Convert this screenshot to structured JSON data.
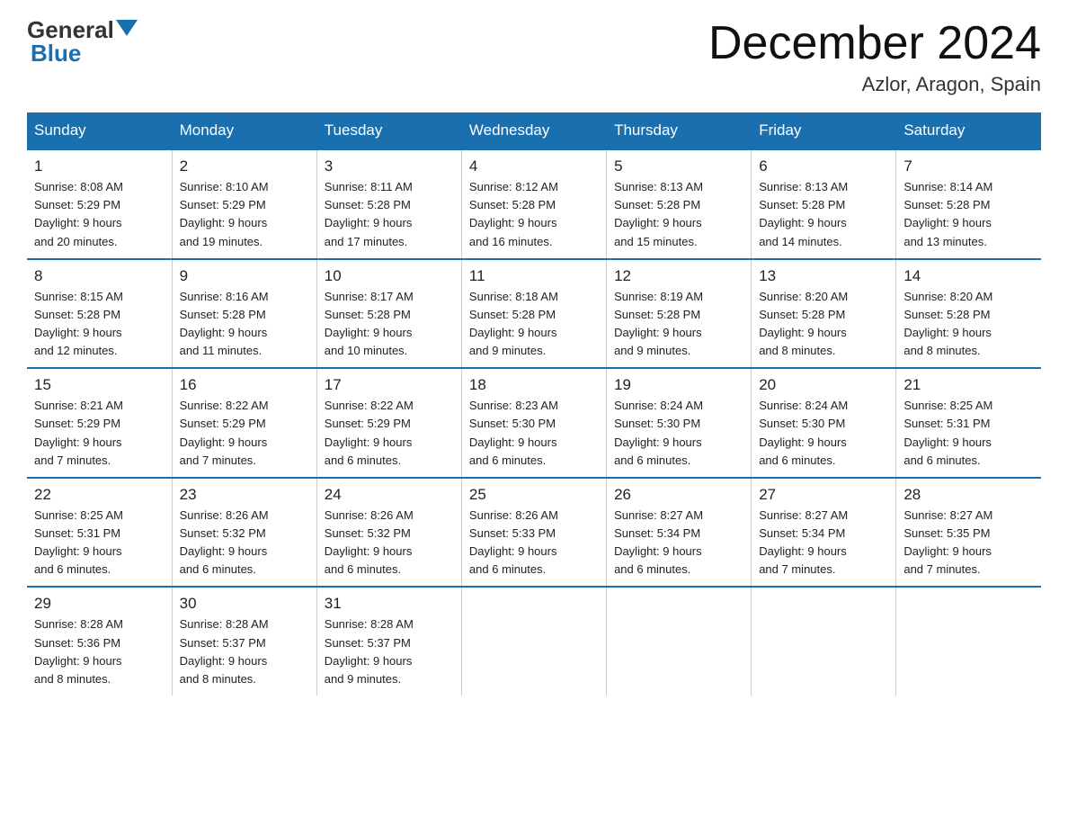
{
  "header": {
    "logo_general": "General",
    "logo_blue": "Blue",
    "month_title": "December 2024",
    "location": "Azlor, Aragon, Spain"
  },
  "weekdays": [
    "Sunday",
    "Monday",
    "Tuesday",
    "Wednesday",
    "Thursday",
    "Friday",
    "Saturday"
  ],
  "weeks": [
    [
      {
        "day": "1",
        "sunrise": "8:08 AM",
        "sunset": "5:29 PM",
        "daylight": "9 hours and 20 minutes."
      },
      {
        "day": "2",
        "sunrise": "8:10 AM",
        "sunset": "5:29 PM",
        "daylight": "9 hours and 19 minutes."
      },
      {
        "day": "3",
        "sunrise": "8:11 AM",
        "sunset": "5:28 PM",
        "daylight": "9 hours and 17 minutes."
      },
      {
        "day": "4",
        "sunrise": "8:12 AM",
        "sunset": "5:28 PM",
        "daylight": "9 hours and 16 minutes."
      },
      {
        "day": "5",
        "sunrise": "8:13 AM",
        "sunset": "5:28 PM",
        "daylight": "9 hours and 15 minutes."
      },
      {
        "day": "6",
        "sunrise": "8:13 AM",
        "sunset": "5:28 PM",
        "daylight": "9 hours and 14 minutes."
      },
      {
        "day": "7",
        "sunrise": "8:14 AM",
        "sunset": "5:28 PM",
        "daylight": "9 hours and 13 minutes."
      }
    ],
    [
      {
        "day": "8",
        "sunrise": "8:15 AM",
        "sunset": "5:28 PM",
        "daylight": "9 hours and 12 minutes."
      },
      {
        "day": "9",
        "sunrise": "8:16 AM",
        "sunset": "5:28 PM",
        "daylight": "9 hours and 11 minutes."
      },
      {
        "day": "10",
        "sunrise": "8:17 AM",
        "sunset": "5:28 PM",
        "daylight": "9 hours and 10 minutes."
      },
      {
        "day": "11",
        "sunrise": "8:18 AM",
        "sunset": "5:28 PM",
        "daylight": "9 hours and 9 minutes."
      },
      {
        "day": "12",
        "sunrise": "8:19 AM",
        "sunset": "5:28 PM",
        "daylight": "9 hours and 9 minutes."
      },
      {
        "day": "13",
        "sunrise": "8:20 AM",
        "sunset": "5:28 PM",
        "daylight": "9 hours and 8 minutes."
      },
      {
        "day": "14",
        "sunrise": "8:20 AM",
        "sunset": "5:28 PM",
        "daylight": "9 hours and 8 minutes."
      }
    ],
    [
      {
        "day": "15",
        "sunrise": "8:21 AM",
        "sunset": "5:29 PM",
        "daylight": "9 hours and 7 minutes."
      },
      {
        "day": "16",
        "sunrise": "8:22 AM",
        "sunset": "5:29 PM",
        "daylight": "9 hours and 7 minutes."
      },
      {
        "day": "17",
        "sunrise": "8:22 AM",
        "sunset": "5:29 PM",
        "daylight": "9 hours and 6 minutes."
      },
      {
        "day": "18",
        "sunrise": "8:23 AM",
        "sunset": "5:30 PM",
        "daylight": "9 hours and 6 minutes."
      },
      {
        "day": "19",
        "sunrise": "8:24 AM",
        "sunset": "5:30 PM",
        "daylight": "9 hours and 6 minutes."
      },
      {
        "day": "20",
        "sunrise": "8:24 AM",
        "sunset": "5:30 PM",
        "daylight": "9 hours and 6 minutes."
      },
      {
        "day": "21",
        "sunrise": "8:25 AM",
        "sunset": "5:31 PM",
        "daylight": "9 hours and 6 minutes."
      }
    ],
    [
      {
        "day": "22",
        "sunrise": "8:25 AM",
        "sunset": "5:31 PM",
        "daylight": "9 hours and 6 minutes."
      },
      {
        "day": "23",
        "sunrise": "8:26 AM",
        "sunset": "5:32 PM",
        "daylight": "9 hours and 6 minutes."
      },
      {
        "day": "24",
        "sunrise": "8:26 AM",
        "sunset": "5:32 PM",
        "daylight": "9 hours and 6 minutes."
      },
      {
        "day": "25",
        "sunrise": "8:26 AM",
        "sunset": "5:33 PM",
        "daylight": "9 hours and 6 minutes."
      },
      {
        "day": "26",
        "sunrise": "8:27 AM",
        "sunset": "5:34 PM",
        "daylight": "9 hours and 6 minutes."
      },
      {
        "day": "27",
        "sunrise": "8:27 AM",
        "sunset": "5:34 PM",
        "daylight": "9 hours and 7 minutes."
      },
      {
        "day": "28",
        "sunrise": "8:27 AM",
        "sunset": "5:35 PM",
        "daylight": "9 hours and 7 minutes."
      }
    ],
    [
      {
        "day": "29",
        "sunrise": "8:28 AM",
        "sunset": "5:36 PM",
        "daylight": "9 hours and 8 minutes."
      },
      {
        "day": "30",
        "sunrise": "8:28 AM",
        "sunset": "5:37 PM",
        "daylight": "9 hours and 8 minutes."
      },
      {
        "day": "31",
        "sunrise": "8:28 AM",
        "sunset": "5:37 PM",
        "daylight": "9 hours and 9 minutes."
      },
      null,
      null,
      null,
      null
    ]
  ],
  "labels": {
    "sunrise": "Sunrise:",
    "sunset": "Sunset:",
    "daylight": "Daylight:"
  }
}
